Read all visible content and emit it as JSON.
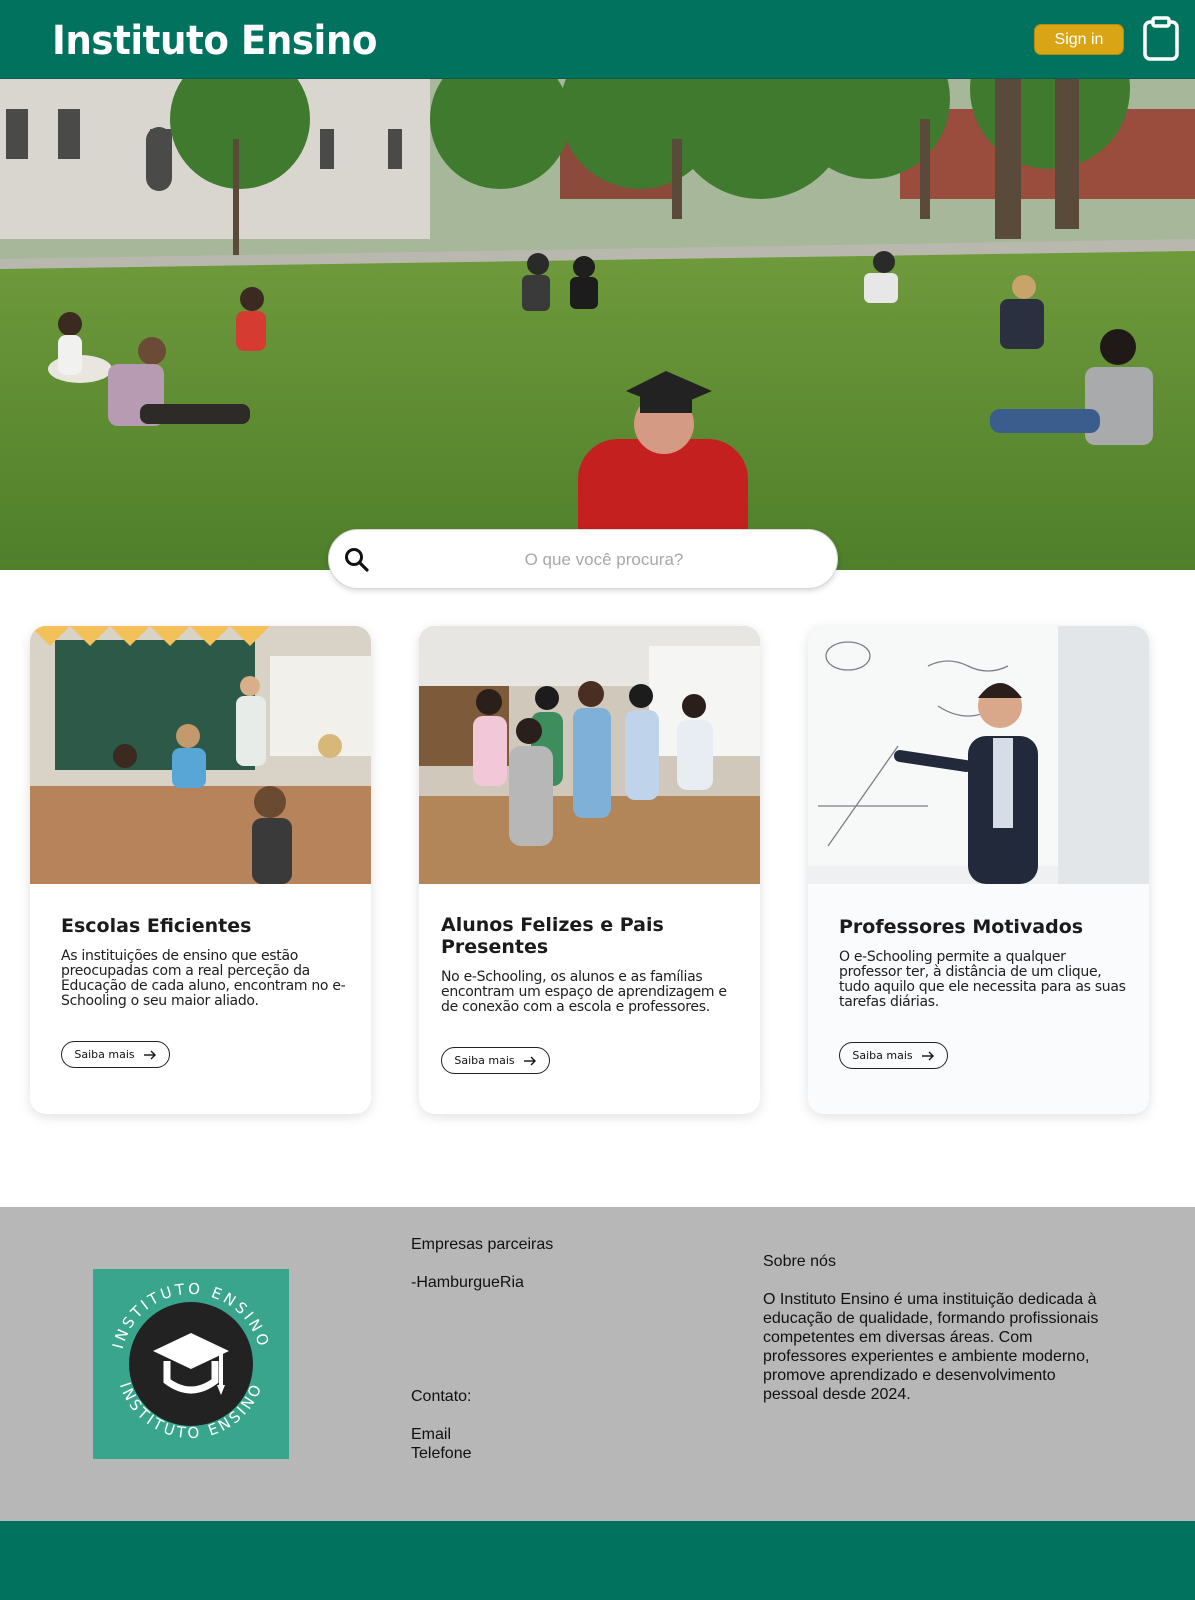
{
  "header": {
    "brand": "Instituto Ensino",
    "signin_label": "Sign in",
    "clipboard_icon": "clipboard-icon"
  },
  "search": {
    "placeholder": "O que você procura?",
    "icon": "search-icon"
  },
  "cards": [
    {
      "title": "Escolas Eficientes",
      "text": "As instituições de ensino que estão preocupadas com a real perceção da Educação de cada aluno, encontram no e-Schooling o seu maior aliado.",
      "button_label": "Saiba mais"
    },
    {
      "title": "Alunos Felizes e Pais Presentes",
      "text": "No e-Schooling, os alunos e as famílias encontram um espaço de aprendizagem e de conexão com a escola e professores.",
      "button_label": "Saiba mais"
    },
    {
      "title": "Professores Motivados",
      "text": "O e-Schooling permite a qualquer professor ter, à distância de um clique, tudo aquilo que ele necessita para as suas tarefas diárias.",
      "button_label": "Saiba mais"
    }
  ],
  "footer": {
    "logo_text": "INSTITUTO ENSINO",
    "partners_title": "Empresas parceiras",
    "partners": [
      "-HamburgueRia"
    ],
    "contact_title": "Contato:",
    "contact_email": "Email",
    "contact_phone": "Telefone",
    "about_title": "Sobre nós",
    "about_text": "O Instituto Ensino é uma instituição dedicada à educação de qualidade, formando profissionais competentes em diversas áreas. Com professores experientes e ambiente moderno, promove aprendizado e desenvolvimento pessoal desde 2024."
  },
  "colors": {
    "primary": "#00725e",
    "accent": "#d9a514",
    "footer_bg": "#b7b7b7",
    "logo_bg": "#3aa58d"
  }
}
